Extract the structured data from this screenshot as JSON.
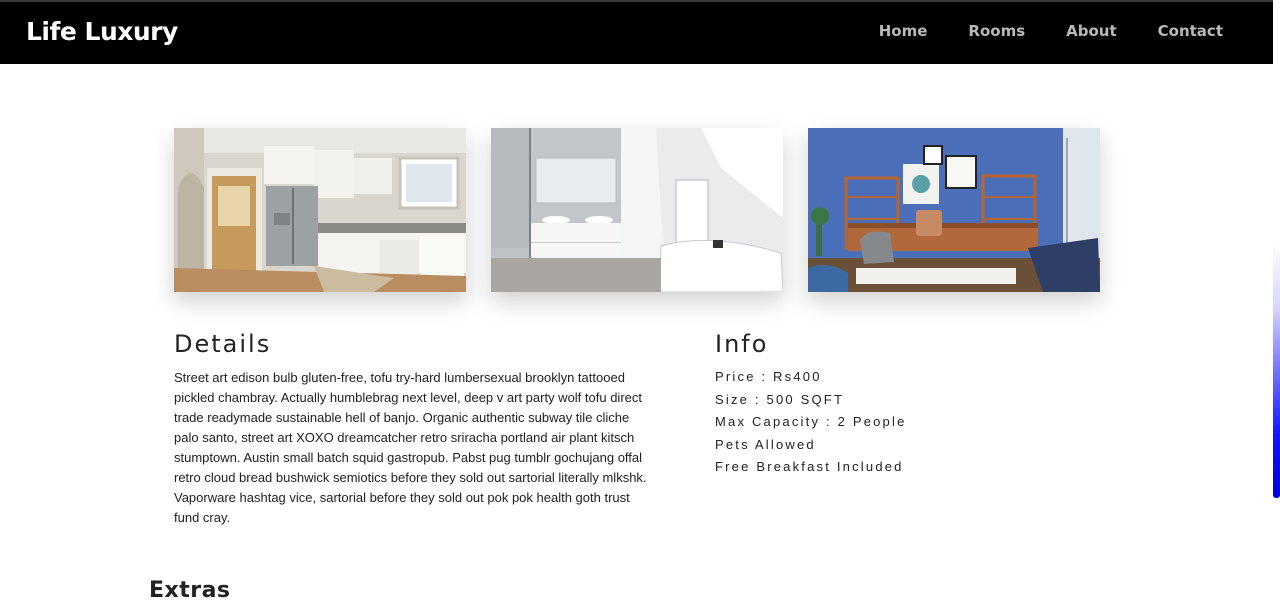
{
  "brand": "Life Luxury",
  "nav": {
    "items": [
      {
        "label": "Home"
      },
      {
        "label": "Rooms"
      },
      {
        "label": "About"
      },
      {
        "label": "Contact"
      }
    ]
  },
  "gallery": {
    "photos": [
      {
        "subject": "kitchen"
      },
      {
        "subject": "bathroom"
      },
      {
        "subject": "study room"
      }
    ]
  },
  "details": {
    "title": "Details",
    "text": "Street art edison bulb gluten-free, tofu try-hard lumbersexual brooklyn tattooed pickled chambray. Actually humblebrag next level, deep v art party wolf tofu direct trade readymade sustainable hell of banjo. Organic authentic subway tile cliche palo santo, street art XOXO dreamcatcher retro sriracha portland air plant kitsch stumptown. Austin small batch squid gastropub. Pabst pug tumblr gochujang offal retro cloud bread bushwick semiotics before they sold out sartorial literally mlkshk. Vaporware hashtag vice, sartorial before they sold out pok pok health goth trust fund cray."
  },
  "info": {
    "title": "Info",
    "items": [
      "Price : Rs400",
      "Size : 500 SQFT",
      "Max Capacity : 2 People",
      "Pets Allowed",
      "Free Breakfast Included"
    ]
  },
  "extras": {
    "title": "Extras"
  },
  "colors": {
    "navbar_bg": "#000000",
    "nav_link": "#b9b9b9",
    "brand_text": "#ffffff",
    "scrollbar_thumb": "#0000d8"
  }
}
